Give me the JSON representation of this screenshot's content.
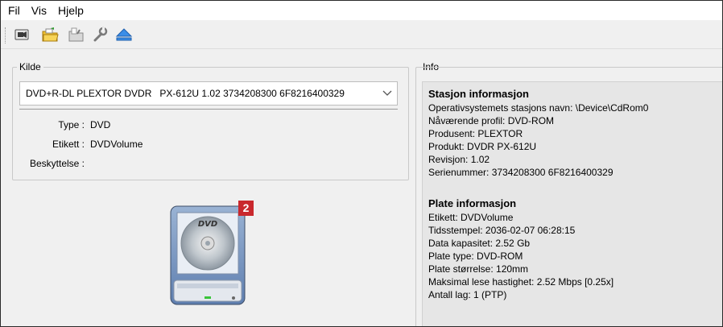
{
  "menu": [
    {
      "label": "Fil"
    },
    {
      "label": "Vis"
    },
    {
      "label": "Hjelp"
    }
  ],
  "toolbar": [
    {
      "icon": "read-icon"
    },
    {
      "icon": "open-folder-icon"
    },
    {
      "icon": "save-icon"
    },
    {
      "icon": "wrench-icon"
    },
    {
      "icon": "eject-icon"
    }
  ],
  "source": {
    "title": "Kilde",
    "drive_selected": "DVD+R-DL PLEXTOR DVDR   PX-612U 1.02 3734208300 6F8216400329",
    "type_label": "Type :",
    "type_value": "DVD",
    "label_label": "Etikett :",
    "label_value": "DVDVolume",
    "protection_label": "Beskyttelse :",
    "protection_value": ""
  },
  "badge": "2",
  "info": {
    "title": "Info",
    "drive_heading": "Stasjon informasjon",
    "drive_lines": [
      "Operativsystemets stasjons navn: \\Device\\CdRom0",
      "Nåværende profil: DVD-ROM",
      "Produsent: PLEXTOR",
      "Produkt: DVDR PX-612U",
      "Revisjon: 1.02",
      "Serienummer: 3734208300 6F8216400329"
    ],
    "disc_heading": "Plate informasjon",
    "disc_lines": [
      "Etikett: DVDVolume",
      "Tidsstempel: 2036-02-07 06:28:15",
      "Data kapasitet: 2.52 Gb",
      "Plate type: DVD-ROM",
      "Plate størrelse: 120mm",
      "Maksimal lese hastighet: 2.52 Mbps [0.25x]",
      "Antall lag: 1 (PTP)"
    ]
  },
  "colors": {
    "badge": "#c9282d",
    "accent": "#1e6fc4"
  }
}
